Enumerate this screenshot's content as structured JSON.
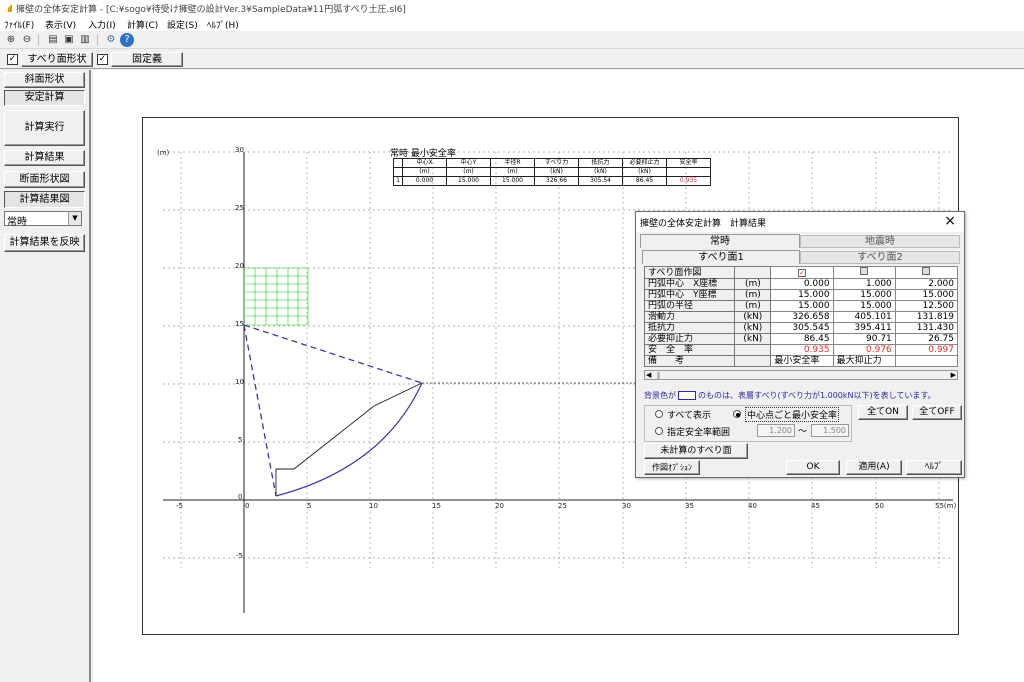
{
  "window": {
    "title": "擁壁の全体安定計算 - [C:¥sogo¥待受け擁壁の設計Ver.3¥SampleData¥11円弧すべり土圧.sl6]"
  },
  "menu": [
    "ﾌｧｲﾙ(F)",
    "表示(V)",
    "入力(I)",
    "計算(C)",
    "設定(S)",
    "ﾍﾙﾌﾟ(H)"
  ],
  "options": {
    "slip_shape": "すべり面形状",
    "fixed_def": "固定義"
  },
  "sidebar": {
    "items": [
      "斜面形状",
      "安定計算",
      "計算実行",
      "計算結果",
      "断面形状図",
      "計算結果図"
    ],
    "case_select": "常時",
    "apply": "計算結果を反映"
  },
  "plot": {
    "caption": "常時  最小安全率",
    "unit_y": "(m)",
    "unit_x": "(m)",
    "x_ticks": [
      "-5",
      "0",
      "5",
      "10",
      "15",
      "20",
      "25",
      "30",
      "35",
      "40",
      "45",
      "50"
    ],
    "x_last": "55(m)",
    "y_ticks": [
      "30",
      "25",
      "20",
      "15",
      "10",
      "5",
      "0",
      "-5"
    ],
    "result_table": {
      "headers": [
        [
          "",
          "中心X",
          "中心Y",
          "半径R",
          "すべり力",
          "抵抗力",
          "必要抑止力",
          "安全率"
        ],
        [
          "",
          "(m)",
          "(m)",
          "(m)",
          "(kN)",
          "(kN)",
          "(kN)",
          ""
        ]
      ],
      "row": [
        "1",
        "0.000",
        "15.000",
        "15.000",
        "326.66",
        "305.54",
        "86.45",
        "0.935"
      ]
    }
  },
  "dialog": {
    "title": "擁壁の全体安定計算　計算結果",
    "tabs": [
      "常時",
      "地震時"
    ],
    "subtabs": [
      "すべり面1",
      "すべり面2"
    ],
    "rows": [
      {
        "label": "すべり面作図",
        "unit": "",
        "vals": [
          "",
          "",
          ""
        ]
      },
      {
        "label": "円弧中心　X座標",
        "unit": "(m)",
        "vals": [
          "0.000",
          "1.000",
          "2.000"
        ]
      },
      {
        "label": "円弧中心　Y座標",
        "unit": "(m)",
        "vals": [
          "15.000",
          "15.000",
          "15.000"
        ]
      },
      {
        "label": "円弧の半径",
        "unit": "(m)",
        "vals": [
          "15.000",
          "15.000",
          "12.500"
        ]
      },
      {
        "label": "滑動力",
        "unit": "(kN)",
        "vals": [
          "326.658",
          "405.101",
          "131.819"
        ]
      },
      {
        "label": "抵抗力",
        "unit": "(kN)",
        "vals": [
          "305.545",
          "395.411",
          "131.430"
        ]
      },
      {
        "label": "必要抑止力",
        "unit": "(kN)",
        "vals": [
          "86.45",
          "90.71",
          "26.75"
        ]
      },
      {
        "label": "安　全　率",
        "unit": "",
        "vals": [
          "0.935",
          "0.976",
          "0.997"
        ]
      },
      {
        "label": "備　　考",
        "unit": "",
        "vals": [
          "最小安全率",
          "最大抑止力",
          ""
        ]
      }
    ],
    "note_pre": "背景色が",
    "note_post": "のものは、表層すべり(すべり力が1.000kN以下)を表しています。",
    "radio_all": "すべて表示",
    "radio_center": "中心点ごと最小安全率",
    "radio_range": "指定安全率範囲",
    "range_from": "1.200",
    "range_sep": "～",
    "range_to": "1.500",
    "btn_all_on": "全てON",
    "btn_all_off": "全てOFF",
    "btn_uncalc": "未計算のすべり面",
    "btn_opt": "作図ｵﾌﾟｼｮﾝ",
    "btn_ok": "OK",
    "btn_apply": "適用(A)",
    "btn_help": "ﾍﾙﾌﾟ",
    "colors": {
      "red": "#e0302c"
    }
  }
}
